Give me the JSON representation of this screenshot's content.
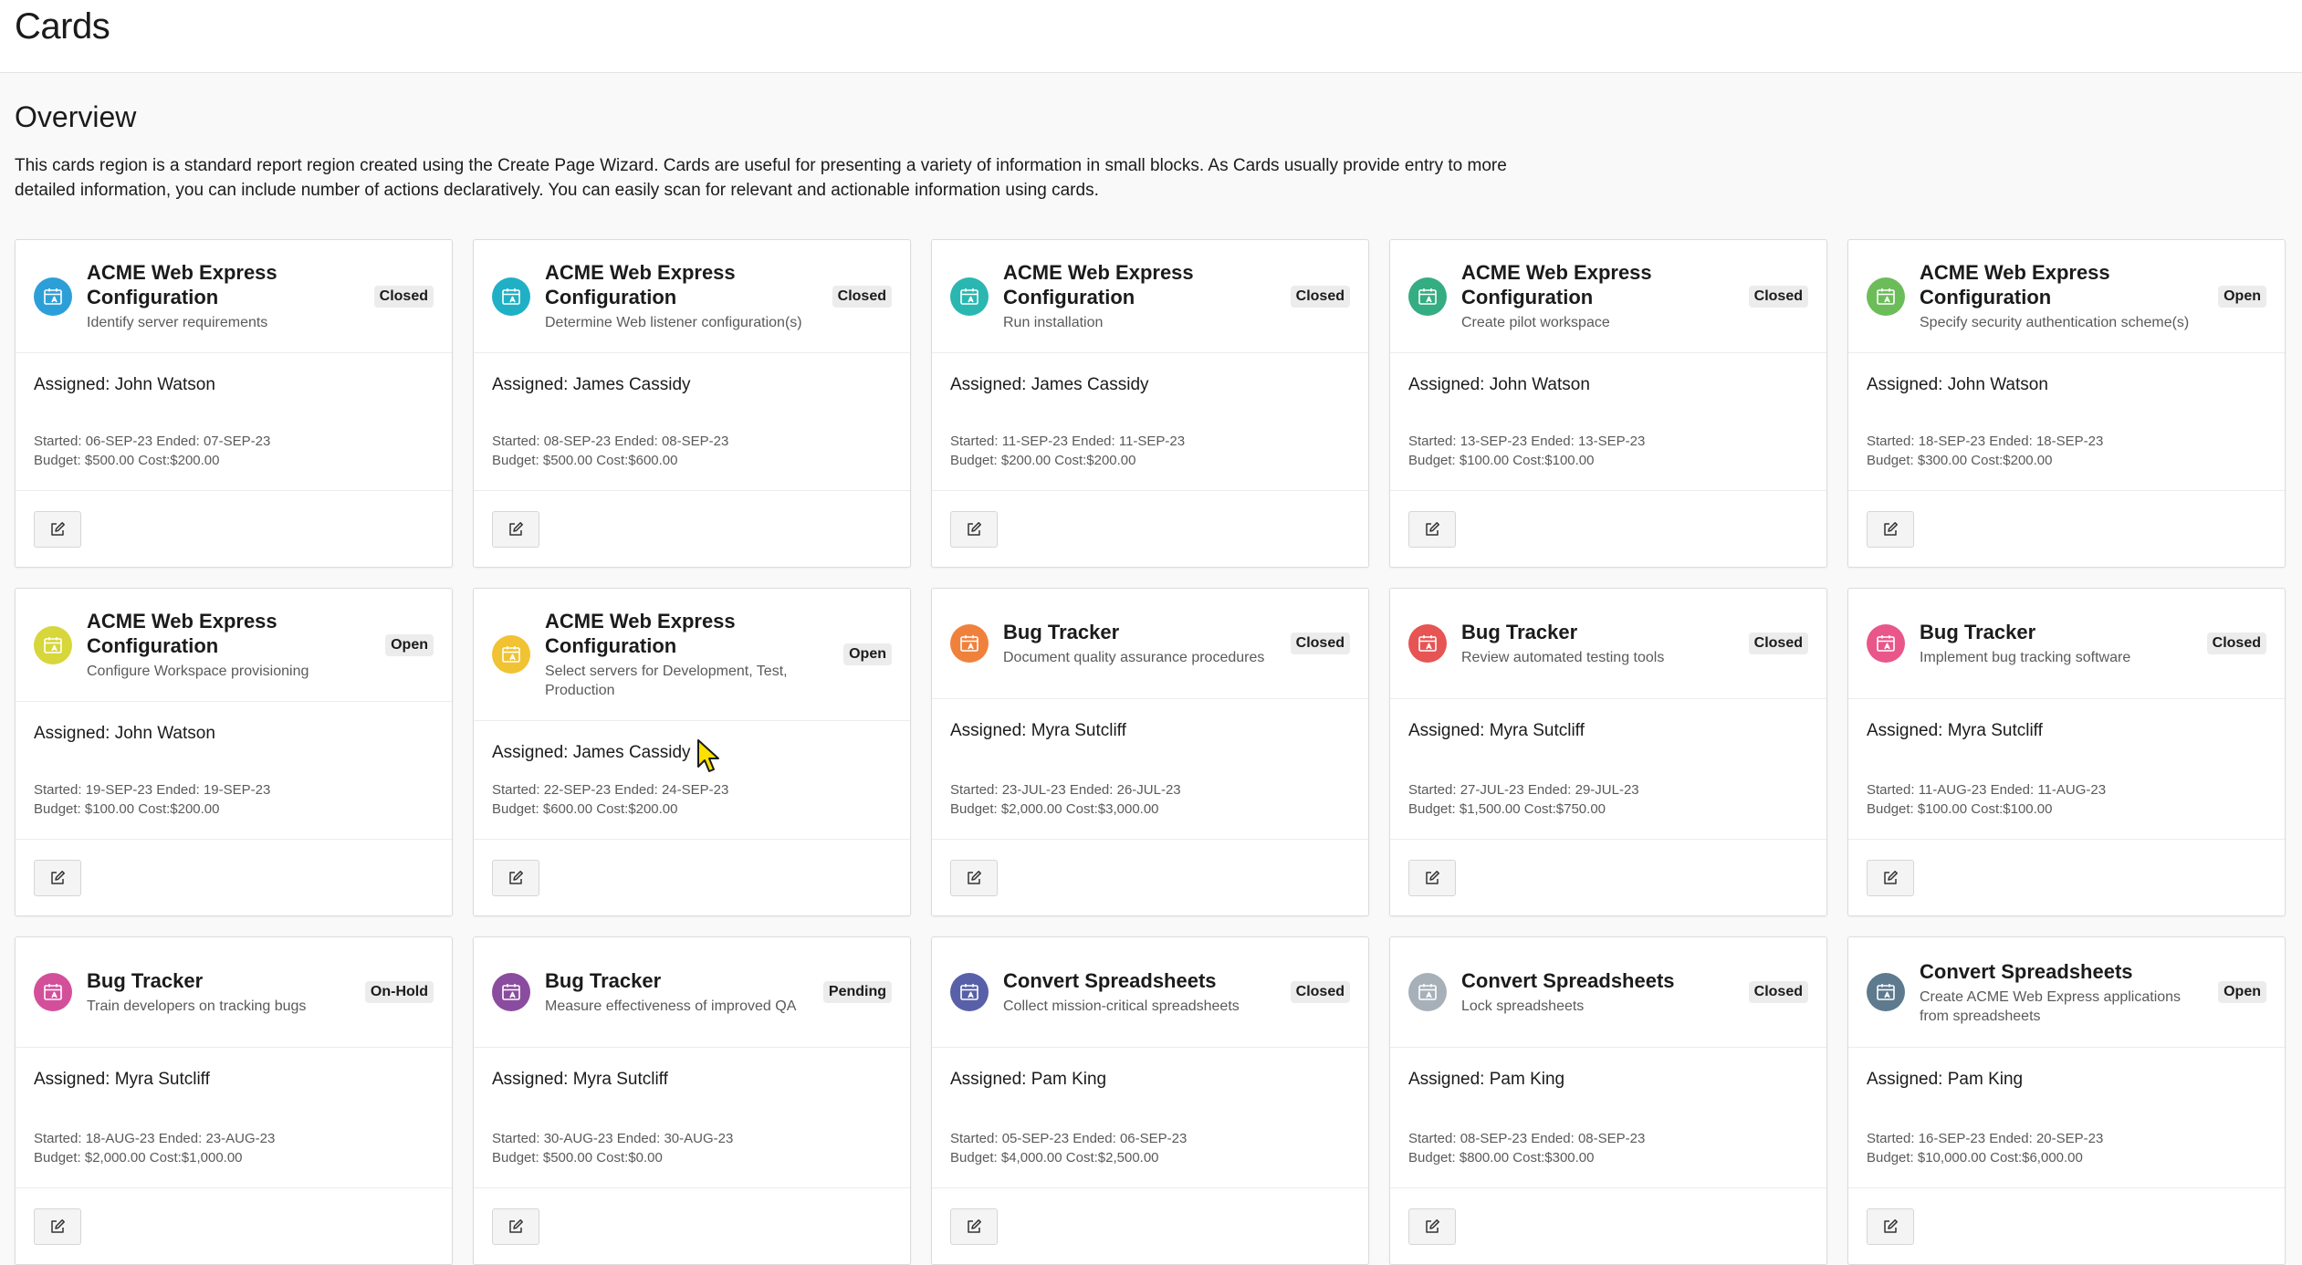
{
  "page": {
    "title": "Cards"
  },
  "overview": {
    "heading": "Overview",
    "description": "This cards region is a standard report region created using the Create Page Wizard. Cards are useful for presenting a variety of information in small blocks. As Cards usually provide entry to more detailed information, you can include number of actions declaratively. You can easily scan for relevant and actionable information using cards."
  },
  "cards": [
    {
      "title": "ACME Web Express Configuration",
      "subtitle": "Identify server requirements",
      "status": "Closed",
      "assigned": "Assigned: John Watson",
      "dates": "Started: 06-SEP-23 Ended: 07-SEP-23",
      "budget": "Budget: $500.00 Cost:$200.00",
      "icon_color": "#2d9fd8",
      "icon": "calendar-user-icon"
    },
    {
      "title": "ACME Web Express Configuration",
      "subtitle": "Determine Web listener configuration(s)",
      "status": "Closed",
      "assigned": "Assigned: James Cassidy",
      "dates": "Started: 08-SEP-23 Ended: 08-SEP-23",
      "budget": "Budget: $500.00 Cost:$600.00",
      "icon_color": "#1fb0c6",
      "icon": "calendar-user-icon"
    },
    {
      "title": "ACME Web Express Configuration",
      "subtitle": "Run installation",
      "status": "Closed",
      "assigned": "Assigned: James Cassidy",
      "dates": "Started: 11-SEP-23 Ended: 11-SEP-23",
      "budget": "Budget: $200.00 Cost:$200.00",
      "icon_color": "#2ab7b1",
      "icon": "calendar-user-icon"
    },
    {
      "title": "ACME Web Express Configuration",
      "subtitle": "Create pilot workspace",
      "status": "Closed",
      "assigned": "Assigned: John Watson",
      "dates": "Started: 13-SEP-23 Ended: 13-SEP-23",
      "budget": "Budget: $100.00 Cost:$100.00",
      "icon_color": "#35ad82",
      "icon": "calendar-user-icon"
    },
    {
      "title": "ACME Web Express Configuration",
      "subtitle": "Specify security authentication scheme(s)",
      "status": "Open",
      "assigned": "Assigned: John Watson",
      "dates": "Started: 18-SEP-23 Ended: 18-SEP-23",
      "budget": "Budget: $300.00 Cost:$200.00",
      "icon_color": "#6cbd5a",
      "icon": "calendar-user-icon"
    },
    {
      "title": "ACME Web Express Configuration",
      "subtitle": "Configure Workspace provisioning",
      "status": "Open",
      "assigned": "Assigned: John Watson",
      "dates": "Started: 19-SEP-23 Ended: 19-SEP-23",
      "budget": "Budget: $100.00 Cost:$200.00",
      "icon_color": "#d7d63a",
      "icon": "calendar-user-icon"
    },
    {
      "title": "ACME Web Express Configuration",
      "subtitle": "Select servers for Development, Test, Production",
      "status": "Open",
      "assigned": "Assigned: James Cassidy",
      "dates": "Started: 22-SEP-23 Ended: 24-SEP-23",
      "budget": "Budget: $600.00 Cost:$200.00",
      "icon_color": "#f1c232",
      "icon": "calendar-user-icon"
    },
    {
      "title": "Bug Tracker",
      "subtitle": "Document quality assurance procedures",
      "status": "Closed",
      "assigned": "Assigned: Myra Sutcliff",
      "dates": "Started: 23-JUL-23 Ended: 26-JUL-23",
      "budget": "Budget: $2,000.00 Cost:$3,000.00",
      "icon_color": "#f0813c",
      "icon": "calendar-user-icon"
    },
    {
      "title": "Bug Tracker",
      "subtitle": "Review automated testing tools",
      "status": "Closed",
      "assigned": "Assigned: Myra Sutcliff",
      "dates": "Started: 27-JUL-23 Ended: 29-JUL-23",
      "budget": "Budget: $1,500.00 Cost:$750.00",
      "icon_color": "#e75454",
      "icon": "calendar-user-icon"
    },
    {
      "title": "Bug Tracker",
      "subtitle": "Implement bug tracking software",
      "status": "Closed",
      "assigned": "Assigned: Myra Sutcliff",
      "dates": "Started: 11-AUG-23 Ended: 11-AUG-23",
      "budget": "Budget: $100.00 Cost:$100.00",
      "icon_color": "#e8568a",
      "icon": "calendar-user-icon"
    },
    {
      "title": "Bug Tracker",
      "subtitle": "Train developers on tracking bugs",
      "status": "On-Hold",
      "assigned": "Assigned: Myra Sutcliff",
      "dates": "Started: 18-AUG-23 Ended: 23-AUG-23",
      "budget": "Budget: $2,000.00 Cost:$1,000.00",
      "icon_color": "#d44f9a",
      "icon": "calendar-user-icon"
    },
    {
      "title": "Bug Tracker",
      "subtitle": "Measure effectiveness of improved QA",
      "status": "Pending",
      "assigned": "Assigned: Myra Sutcliff",
      "dates": "Started: 30-AUG-23 Ended: 30-AUG-23",
      "budget": "Budget: $500.00 Cost:$0.00",
      "icon_color": "#8a4c9e",
      "icon": "calendar-user-icon"
    },
    {
      "title": "Convert Spreadsheets",
      "subtitle": "Collect mission-critical spreadsheets",
      "status": "Closed",
      "assigned": "Assigned: Pam King",
      "dates": "Started: 05-SEP-23 Ended: 06-SEP-23",
      "budget": "Budget: $4,000.00 Cost:$2,500.00",
      "icon_color": "#5760a8",
      "icon": "calendar-user-icon"
    },
    {
      "title": "Convert Spreadsheets",
      "subtitle": "Lock spreadsheets",
      "status": "Closed",
      "assigned": "Assigned: Pam King",
      "dates": "Started: 08-SEP-23 Ended: 08-SEP-23",
      "budget": "Budget: $800.00 Cost:$300.00",
      "icon_color": "#a7b0b8",
      "icon": "calendar-user-icon"
    },
    {
      "title": "Convert Spreadsheets",
      "subtitle": "Create ACME Web Express applications from spreadsheets",
      "status": "Open",
      "assigned": "Assigned: Pam King",
      "dates": "Started: 16-SEP-23 Ended: 20-SEP-23",
      "budget": "Budget: $10,000.00 Cost:$6,000.00",
      "icon_color": "#5d7a8e",
      "icon": "calendar-user-icon"
    }
  ]
}
